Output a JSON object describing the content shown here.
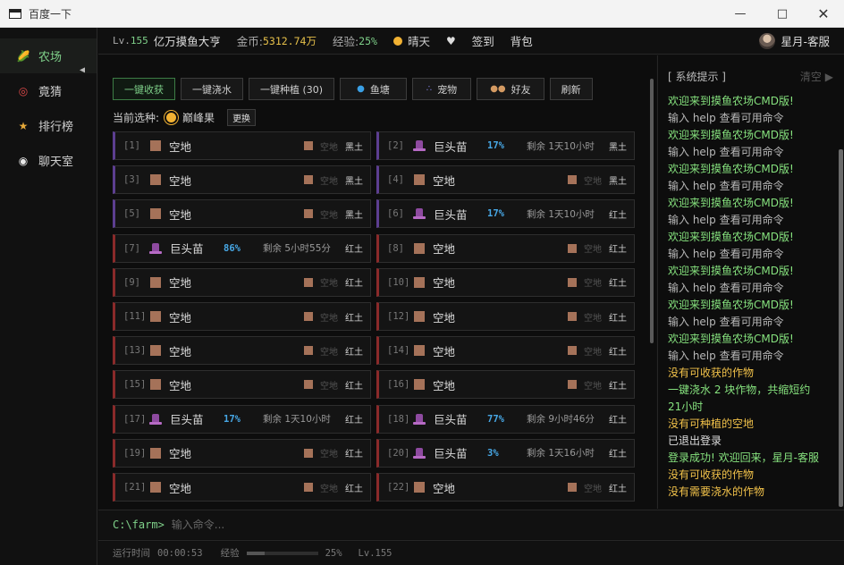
{
  "window": {
    "title": "百度一下"
  },
  "sidebar": {
    "items": [
      {
        "label": "农场",
        "icon": "corn-icon",
        "active": true
      },
      {
        "label": "竟猜",
        "icon": "target-icon",
        "active": false
      },
      {
        "label": "排行榜",
        "icon": "trophy-icon",
        "active": false
      },
      {
        "label": "聊天室",
        "icon": "speech-bubble-icon",
        "active": false
      }
    ]
  },
  "header": {
    "level_prefix": "Lv.",
    "level": "155",
    "player_title": "亿万摸鱼大亨",
    "gold_label": "金币:",
    "gold": "5312.74万",
    "exp_label": "经验:",
    "exp": "25%",
    "weather": "晴天",
    "checkin": "签到",
    "bag": "背包",
    "username": "星月-客服"
  },
  "toolbar": {
    "harvest": "一键收获",
    "water": "一键浇水",
    "plant": "一键种植 (30)",
    "pond": "鱼塘",
    "pet": "宠物",
    "friends": "好友",
    "refresh": "刷新"
  },
  "seed": {
    "label": "当前选种:",
    "name": "巅峰果",
    "change": "更换"
  },
  "plots": [
    {
      "idx": "[1]",
      "crop": "空地",
      "pct": "",
      "remain": "",
      "status": "空地",
      "soil": "黑土",
      "empty": true
    },
    {
      "idx": "[2]",
      "crop": "巨头苗",
      "pct": "17%",
      "remain": "剩余 1天10小时",
      "status": "",
      "soil": "黑土",
      "empty": false
    },
    {
      "idx": "[3]",
      "crop": "空地",
      "pct": "",
      "remain": "",
      "status": "空地",
      "soil": "黑土",
      "empty": true
    },
    {
      "idx": "[4]",
      "crop": "空地",
      "pct": "",
      "remain": "",
      "status": "空地",
      "soil": "黑土",
      "empty": true
    },
    {
      "idx": "[5]",
      "crop": "空地",
      "pct": "",
      "remain": "",
      "status": "空地",
      "soil": "黑土",
      "empty": true
    },
    {
      "idx": "[6]",
      "crop": "巨头苗",
      "pct": "17%",
      "remain": "剩余 1天10小时",
      "status": "",
      "soil": "红土",
      "empty": false
    },
    {
      "idx": "[7]",
      "crop": "巨头苗",
      "pct": "86%",
      "remain": "剩余 5小时55分",
      "status": "",
      "soil": "红土",
      "empty": false
    },
    {
      "idx": "[8]",
      "crop": "空地",
      "pct": "",
      "remain": "",
      "status": "空地",
      "soil": "红土",
      "empty": true
    },
    {
      "idx": "[9]",
      "crop": "空地",
      "pct": "",
      "remain": "",
      "status": "空地",
      "soil": "红土",
      "empty": true
    },
    {
      "idx": "[10]",
      "crop": "空地",
      "pct": "",
      "remain": "",
      "status": "空地",
      "soil": "红土",
      "empty": true
    },
    {
      "idx": "[11]",
      "crop": "空地",
      "pct": "",
      "remain": "",
      "status": "空地",
      "soil": "红土",
      "empty": true
    },
    {
      "idx": "[12]",
      "crop": "空地",
      "pct": "",
      "remain": "",
      "status": "空地",
      "soil": "红土",
      "empty": true
    },
    {
      "idx": "[13]",
      "crop": "空地",
      "pct": "",
      "remain": "",
      "status": "空地",
      "soil": "红土",
      "empty": true
    },
    {
      "idx": "[14]",
      "crop": "空地",
      "pct": "",
      "remain": "",
      "status": "空地",
      "soil": "红土",
      "empty": true
    },
    {
      "idx": "[15]",
      "crop": "空地",
      "pct": "",
      "remain": "",
      "status": "空地",
      "soil": "红土",
      "empty": true
    },
    {
      "idx": "[16]",
      "crop": "空地",
      "pct": "",
      "remain": "",
      "status": "空地",
      "soil": "红土",
      "empty": true
    },
    {
      "idx": "[17]",
      "crop": "巨头苗",
      "pct": "17%",
      "remain": "剩余 1天10小时",
      "status": "",
      "soil": "红土",
      "empty": false
    },
    {
      "idx": "[18]",
      "crop": "巨头苗",
      "pct": "77%",
      "remain": "剩余 9小时46分",
      "status": "",
      "soil": "红土",
      "empty": false
    },
    {
      "idx": "[19]",
      "crop": "空地",
      "pct": "",
      "remain": "",
      "status": "空地",
      "soil": "红土",
      "empty": true
    },
    {
      "idx": "[20]",
      "crop": "巨头苗",
      "pct": "3%",
      "remain": "剩余 1天16小时",
      "status": "",
      "soil": "红土",
      "empty": false
    },
    {
      "idx": "[21]",
      "crop": "空地",
      "pct": "",
      "remain": "",
      "status": "空地",
      "soil": "红土",
      "empty": true
    },
    {
      "idx": "[22]",
      "crop": "空地",
      "pct": "",
      "remain": "",
      "status": "空地",
      "soil": "红土",
      "empty": true
    }
  ],
  "log": {
    "title": "[ 系统提示 ]",
    "clear": "清空",
    "entries": [
      {
        "type": "welcome",
        "text": "欢迎来到摸鱼农场CMD版!"
      },
      {
        "type": "hint",
        "text": "输入 help 查看可用命令"
      },
      {
        "type": "welcome",
        "text": "欢迎来到摸鱼农场CMD版!"
      },
      {
        "type": "hint",
        "text": "输入 help 查看可用命令"
      },
      {
        "type": "welcome",
        "text": "欢迎来到摸鱼农场CMD版!"
      },
      {
        "type": "hint",
        "text": "输入 help 查看可用命令"
      },
      {
        "type": "welcome",
        "text": "欢迎来到摸鱼农场CMD版!"
      },
      {
        "type": "hint",
        "text": "输入 help 查看可用命令"
      },
      {
        "type": "welcome",
        "text": "欢迎来到摸鱼农场CMD版!"
      },
      {
        "type": "hint",
        "text": "输入 help 查看可用命令"
      },
      {
        "type": "welcome",
        "text": "欢迎来到摸鱼农场CMD版!"
      },
      {
        "type": "hint",
        "text": "输入 help 查看可用命令"
      },
      {
        "type": "welcome",
        "text": "欢迎来到摸鱼农场CMD版!"
      },
      {
        "type": "hint",
        "text": "输入 help 查看可用命令"
      },
      {
        "type": "welcome",
        "text": "欢迎来到摸鱼农场CMD版!"
      },
      {
        "type": "hint",
        "text": "输入 help 查看可用命令"
      },
      {
        "type": "warn",
        "text": "没有可收获的作物"
      },
      {
        "type": "ok",
        "text": "一键浇水 2 块作物，共缩短约\n21小时"
      },
      {
        "type": "warn",
        "text": "没有可种植的空地"
      },
      {
        "type": "info",
        "text": "已退出登录"
      },
      {
        "type": "ok",
        "text": "登录成功! 欢迎回来，星月-客服"
      },
      {
        "type": "warn",
        "text": "没有可收获的作物"
      },
      {
        "type": "warn",
        "text": "没有需要浇水的作物"
      }
    ]
  },
  "command": {
    "prompt": "C:\\farm>",
    "placeholder": "输入命令..."
  },
  "status": {
    "runtime_label": "运行时间",
    "runtime": "00:00:53",
    "exp_label": "经验",
    "exp_value": 0.25,
    "exp_text": "25%",
    "level": "Lv.155"
  }
}
